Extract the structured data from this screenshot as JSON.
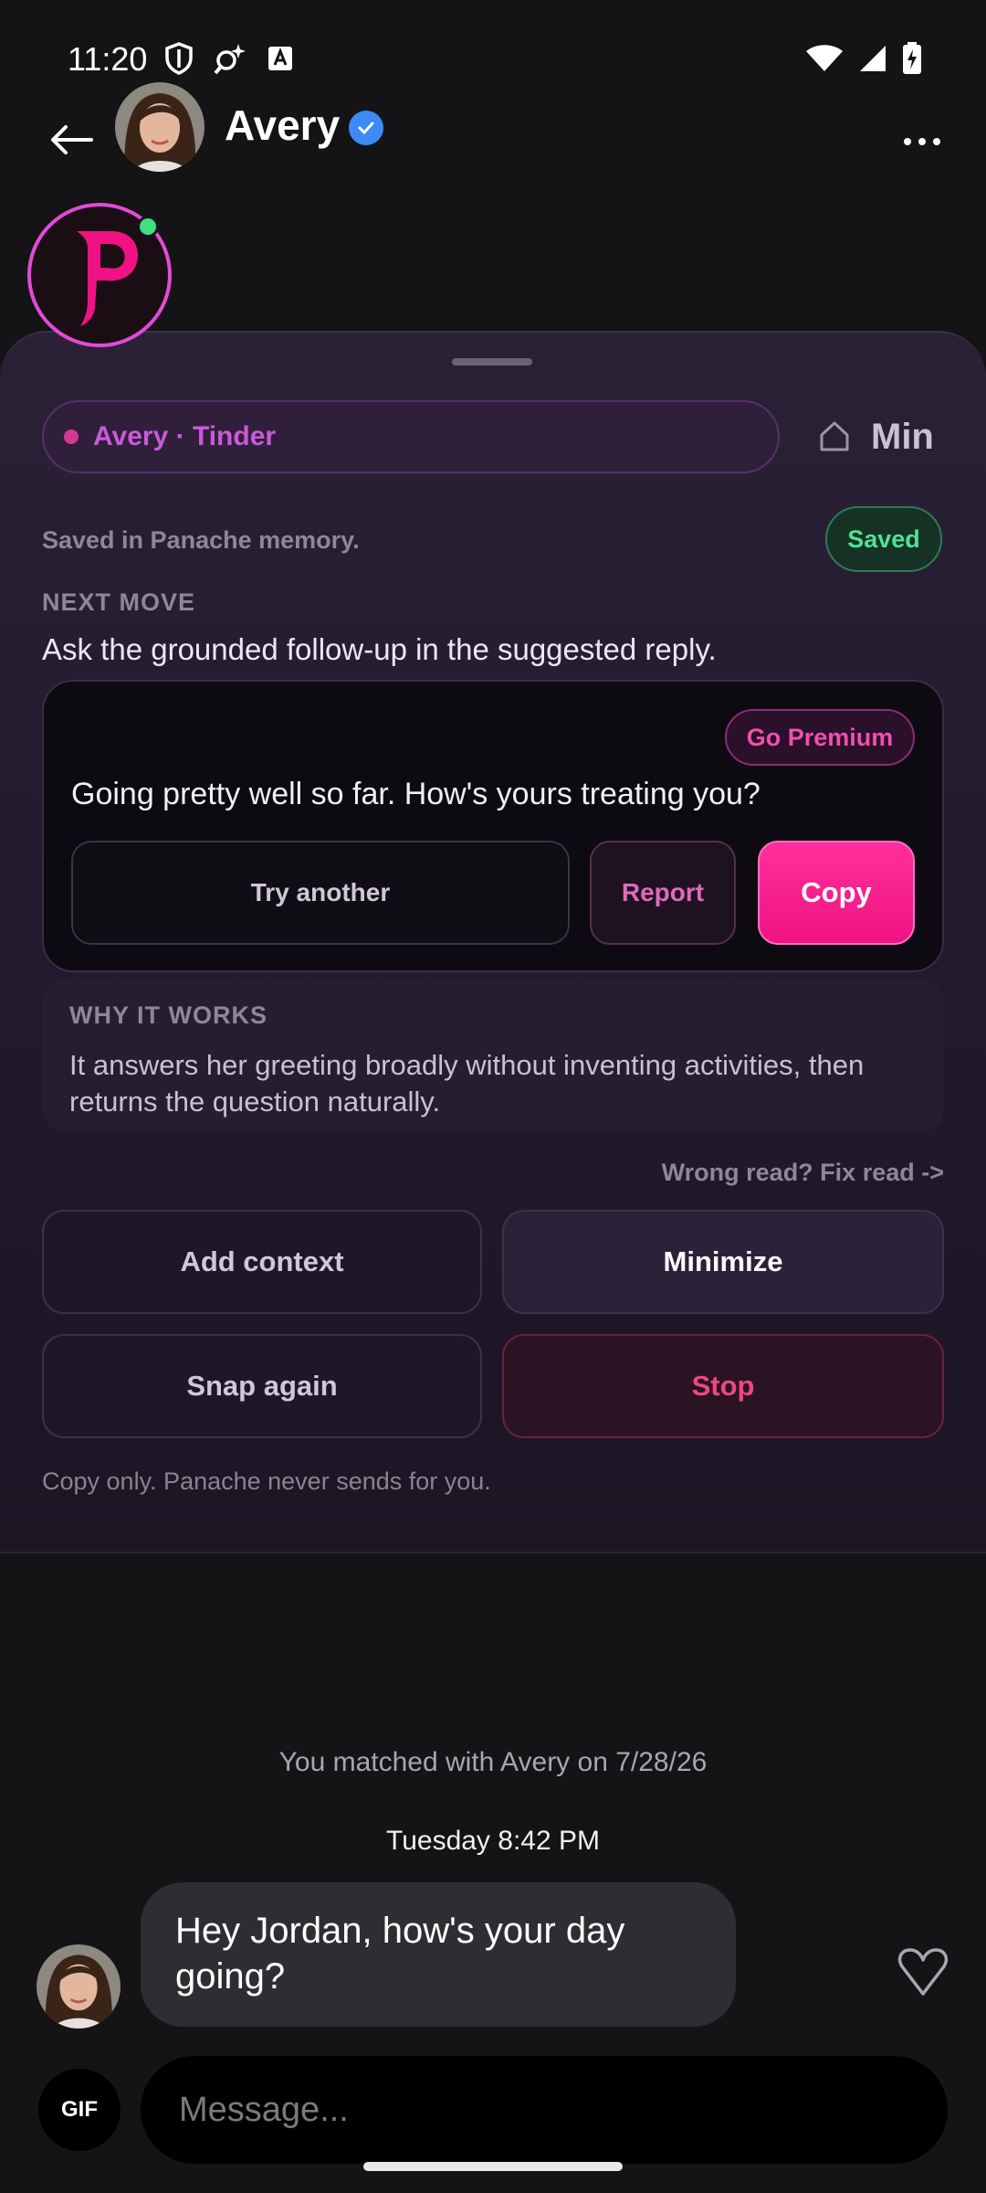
{
  "status_bar": {
    "time": "11:20",
    "left_icons": [
      "shield-icon",
      "search-sparkle-icon",
      "font-icon"
    ],
    "right_icons": [
      "wifi-icon",
      "signal-icon",
      "battery-charging-icon"
    ]
  },
  "header": {
    "name": "Avery",
    "verified": true,
    "accent": "#3d8af7"
  },
  "assistant": {
    "context_label": "Avery · Tinder",
    "minimize_label": "Min",
    "saved_note": "Saved in Panache memory.",
    "saved_badge": "Saved",
    "next_move_heading": "NEXT MOVE",
    "next_move_text": "Ask the grounded follow-up in the suggested reply.",
    "reply": {
      "premium_label": "Go Premium",
      "text": "Going pretty well so far. How's yours treating you?",
      "try_another": "Try another",
      "report": "Report",
      "copy": "Copy"
    },
    "why": {
      "heading": "WHY IT WORKS",
      "text": "It answers her greeting broadly without inventing activities, then returns the question naturally."
    },
    "fix_read": "Wrong read? Fix read ->",
    "actions": {
      "add_context": "Add context",
      "minimize": "Minimize",
      "snap_again": "Snap again",
      "stop": "Stop"
    },
    "footer": "Copy only. Panache never sends for you.",
    "colors": {
      "pink": "#f01283",
      "green": "#4ee292",
      "red": "#f0477e"
    }
  },
  "chat": {
    "match_text": "You matched with Avery on 7/28/26",
    "date": "Tuesday 8:42 PM",
    "message": "Hey Jordan, how's your day going?",
    "gif_label": "GIF",
    "input_placeholder": "Message..."
  }
}
